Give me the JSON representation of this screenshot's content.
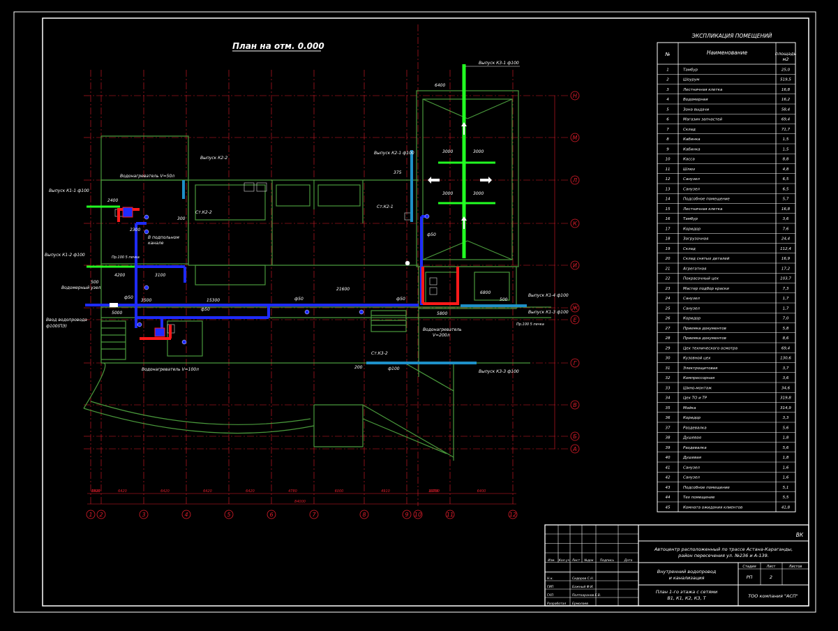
{
  "colors": {
    "background": "#000000",
    "frame": "#ffffff",
    "axis": "#e11d2b",
    "walls": "#4a9a3c",
    "water_supply": "#1e2bff",
    "sewer_main": "#22ff22",
    "sewer_k2": "#1e90c8",
    "hot_water": "#ff1a1a",
    "text": "#ffffff"
  },
  "plan_title": "План на отм. 0.000",
  "explication": {
    "title": "ЭКСПЛИКАЦИЯ ПОМЕЩЕНИЙ",
    "headers": [
      "№",
      "Наименование",
      "площадь м2"
    ],
    "rows": [
      [
        "1",
        "Тамбур",
        "25,0"
      ],
      [
        "2",
        "Шоурум",
        "519,5"
      ],
      [
        "3",
        "Лестничная клетка",
        "16,8"
      ],
      [
        "4",
        "Водомерная",
        "16,2"
      ],
      [
        "5",
        "Зона выдачи",
        "58,4"
      ],
      [
        "6",
        "Магазин запчастей",
        "69,4"
      ],
      [
        "7",
        "Склад",
        "71,7"
      ],
      [
        "8",
        "Кабинка",
        "1,5"
      ],
      [
        "9",
        "Кабинка",
        "1,5"
      ],
      [
        "10",
        "Касса",
        "8,8"
      ],
      [
        "11",
        "Шлюз",
        "4,8"
      ],
      [
        "12",
        "Санузел",
        "6,5"
      ],
      [
        "13",
        "Санузел",
        "6,5"
      ],
      [
        "14",
        "Подсобное помещение",
        "5,7"
      ],
      [
        "15",
        "Лестничная клетка",
        "16,8"
      ],
      [
        "16",
        "Тамбур",
        "3,6"
      ],
      [
        "17",
        "Коридор",
        "7,6"
      ],
      [
        "18",
        "Загрузочная",
        "24,4"
      ],
      [
        "19",
        "Склад",
        "112,4"
      ],
      [
        "20",
        "Склад снятых деталей",
        "16,9"
      ],
      [
        "21",
        "Агрегатная",
        "17,2"
      ],
      [
        "22",
        "Покрасочный цех",
        "103,7"
      ],
      [
        "23",
        "Мастер подбор краски",
        "7,3"
      ],
      [
        "24",
        "Санузел",
        "1,7"
      ],
      [
        "25",
        "Санузел",
        "1,7"
      ],
      [
        "26",
        "Коридор",
        "7,0"
      ],
      [
        "27",
        "Приемка документов",
        "5,8"
      ],
      [
        "28",
        "Приемка документов",
        "8,6"
      ],
      [
        "29",
        "Цех технического осмотра",
        "69,4"
      ],
      [
        "30",
        "Кузовной цех",
        "130,6"
      ],
      [
        "31",
        "Электрощитовая",
        "3,7"
      ],
      [
        "32",
        "Компрессорная",
        "3,6"
      ],
      [
        "33",
        "Шино-монтаж",
        "34,6"
      ],
      [
        "34",
        "Цех ТО и ТР",
        "319,8"
      ],
      [
        "35",
        "Мойка",
        "314,9"
      ],
      [
        "36",
        "Коридор",
        "3,3"
      ],
      [
        "37",
        "Раздевалка",
        "5,6"
      ],
      [
        "38",
        "Душевая",
        "1,8"
      ],
      [
        "39",
        "Раздевалка",
        "5,6"
      ],
      [
        "40",
        "Душевая",
        "1,8"
      ],
      [
        "41",
        "Санузел",
        "1,6"
      ],
      [
        "42",
        "Санузел",
        "1,6"
      ],
      [
        "43",
        "Подсобное помещение",
        "5,1"
      ],
      [
        "44",
        "Тех помещение",
        "5,5"
      ],
      [
        "45",
        "Комната ожидания клиентов",
        "41,8"
      ]
    ]
  },
  "stamp": {
    "code": "ВК",
    "project": "Автоцентр расположенный по трассе Астана-Караганды, район пересечения ул. №236 и А-139.",
    "project_line1": "Автоцентр расположенный по трассе Астана-Караганды,",
    "project_line2": "район пересечения ул. №236 и А-139.",
    "section_line1": "Внутренний водопровод",
    "section_line2": "и канализация",
    "sheet_title_line1": "План 1-го этажа с сетями",
    "sheet_title_line2": "В1, К1, К2, К3, Т",
    "stage_label": "Стадия",
    "sheet_label": "Лист",
    "sheets_label": "Листов",
    "stage": "РП",
    "sheet": "2",
    "sheets": "",
    "company": "ТОО компания \"АСП\"",
    "col_headers": [
      "Изм.",
      "Кол.уч",
      "Лист",
      "№док",
      "Подпись",
      "Дата"
    ],
    "signers": [
      {
        "role": "Н.к.",
        "name": "Сидоров С.Н."
      },
      {
        "role": "ГИП",
        "name": "Бажный Ф.И."
      },
      {
        "role": "ГАП",
        "name": "Полтоаранов Е.В."
      },
      {
        "role": "Разработал",
        "name": "Ермолаев"
      }
    ]
  },
  "axes": {
    "columns": [
      "1",
      "2",
      "3",
      "4",
      "5",
      "6",
      "7",
      "8",
      "9",
      "10",
      "11",
      "12"
    ],
    "rows": [
      "Н",
      "М",
      "Л",
      "К",
      "И",
      "Ж",
      "Е",
      "Г",
      "В",
      "Б",
      "А"
    ],
    "bottom_dims": [
      "1500",
      "6420",
      "6420",
      "6420",
      "6420",
      "6420",
      "4780",
      "6000",
      "4910",
      "",
      "6000",
      "6400"
    ],
    "total_dim": "84000",
    "sub_total": "13700"
  },
  "labels": {
    "vypusk_k3_1": "Выпуск К3-1 ф100",
    "vypusk_k2_1": "Выпуск К2-1 ф100",
    "vypusk_k2_2": "Выпуск К2-2",
    "vypusk_k1_1": "Выпуск К1-1 ф100",
    "vypusk_k1_2": "Выпуск К1-2 ф100",
    "vypusk_k1_3": "Выпуск К1-3 ф100",
    "vypusk_k1_4": "Выпуск К1-4 ф100",
    "vypusk_k3_3": "Выпуск К3-3 ф100",
    "vodonagrevatel_50": "Водонагреватель V=50л",
    "vodonagrevatel_100": "Водонагреватель V=100л",
    "vodonagrevatel_200a": "Водонагреватель",
    "vodonagrevatel_200b": "V=200л",
    "vodomerny_uzel": "Водомерный узел",
    "vvod_1": "Ввод водопровода",
    "vvod_2": "ф100(ПЭ)",
    "st_k2_2": "Ст.К2-2",
    "st_k2_1": "Ст.К2-1",
    "st_k3_2": "Ст.К3-2",
    "d50": "ф50",
    "d100": "ф100",
    "dim_6400": "6400",
    "dim_3000": "3000",
    "dim_21600": "21600",
    "dim_15300": "15300",
    "dim_4200": "4200",
    "dim_3100": "3100",
    "dim_3500": "3500",
    "dim_5000": "5000",
    "dim_2300": "2300",
    "dim_2400": "2400",
    "dim_6800": "6800",
    "dim_5800": "5800",
    "dim_500": "500",
    "dim_300": "300",
    "dim_200": "200",
    "dim_375": "375",
    "pr_pechka": "Пр.100 5 печка",
    "v_podpolnom_1": "В подпольном",
    "v_podpolnom_2": "канале"
  }
}
